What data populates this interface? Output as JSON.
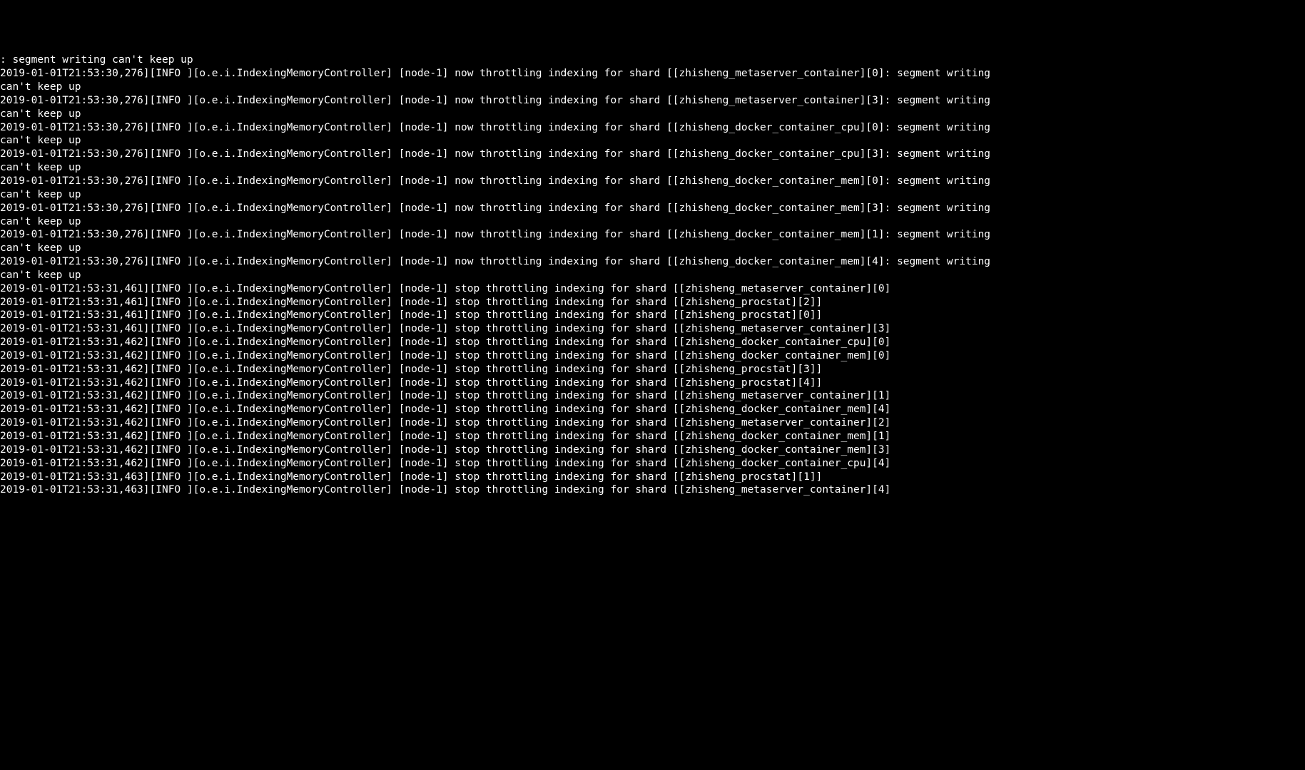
{
  "lines": [
    ": segment writing can't keep up",
    "2019-01-01T21:53:30,276][INFO ][o.e.i.IndexingMemoryController] [node-1] now throttling indexing for shard [[zhisheng_metaserver_container][0]: segment writing can't keep up",
    "2019-01-01T21:53:30,276][INFO ][o.e.i.IndexingMemoryController] [node-1] now throttling indexing for shard [[zhisheng_metaserver_container][3]: segment writing can't keep up",
    "2019-01-01T21:53:30,276][INFO ][o.e.i.IndexingMemoryController] [node-1] now throttling indexing for shard [[zhisheng_docker_container_cpu][0]: segment writing can't keep up",
    "2019-01-01T21:53:30,276][INFO ][o.e.i.IndexingMemoryController] [node-1] now throttling indexing for shard [[zhisheng_docker_container_cpu][3]: segment writing can't keep up",
    "2019-01-01T21:53:30,276][INFO ][o.e.i.IndexingMemoryController] [node-1] now throttling indexing for shard [[zhisheng_docker_container_mem][0]: segment writing can't keep up",
    "2019-01-01T21:53:30,276][INFO ][o.e.i.IndexingMemoryController] [node-1] now throttling indexing for shard [[zhisheng_docker_container_mem][3]: segment writing can't keep up",
    "2019-01-01T21:53:30,276][INFO ][o.e.i.IndexingMemoryController] [node-1] now throttling indexing for shard [[zhisheng_docker_container_mem][1]: segment writing can't keep up",
    "2019-01-01T21:53:30,276][INFO ][o.e.i.IndexingMemoryController] [node-1] now throttling indexing for shard [[zhisheng_docker_container_mem][4]: segment writing can't keep up",
    "2019-01-01T21:53:31,461][INFO ][o.e.i.IndexingMemoryController] [node-1] stop throttling indexing for shard [[zhisheng_metaserver_container][0]",
    "2019-01-01T21:53:31,461][INFO ][o.e.i.IndexingMemoryController] [node-1] stop throttling indexing for shard [[zhisheng_procstat][2]]",
    "2019-01-01T21:53:31,461][INFO ][o.e.i.IndexingMemoryController] [node-1] stop throttling indexing for shard [[zhisheng_procstat][0]]",
    "2019-01-01T21:53:31,461][INFO ][o.e.i.IndexingMemoryController] [node-1] stop throttling indexing for shard [[zhisheng_metaserver_container][3]",
    "2019-01-01T21:53:31,462][INFO ][o.e.i.IndexingMemoryController] [node-1] stop throttling indexing for shard [[zhisheng_docker_container_cpu][0]",
    "2019-01-01T21:53:31,462][INFO ][o.e.i.IndexingMemoryController] [node-1] stop throttling indexing for shard [[zhisheng_docker_container_mem][0]",
    "2019-01-01T21:53:31,462][INFO ][o.e.i.IndexingMemoryController] [node-1] stop throttling indexing for shard [[zhisheng_procstat][3]]",
    "2019-01-01T21:53:31,462][INFO ][o.e.i.IndexingMemoryController] [node-1] stop throttling indexing for shard [[zhisheng_procstat][4]]",
    "2019-01-01T21:53:31,462][INFO ][o.e.i.IndexingMemoryController] [node-1] stop throttling indexing for shard [[zhisheng_metaserver_container][1]",
    "2019-01-01T21:53:31,462][INFO ][o.e.i.IndexingMemoryController] [node-1] stop throttling indexing for shard [[zhisheng_docker_container_mem][4]",
    "2019-01-01T21:53:31,462][INFO ][o.e.i.IndexingMemoryController] [node-1] stop throttling indexing for shard [[zhisheng_metaserver_container][2]",
    "2019-01-01T21:53:31,462][INFO ][o.e.i.IndexingMemoryController] [node-1] stop throttling indexing for shard [[zhisheng_docker_container_mem][1]",
    "2019-01-01T21:53:31,462][INFO ][o.e.i.IndexingMemoryController] [node-1] stop throttling indexing for shard [[zhisheng_docker_container_mem][3]",
    "2019-01-01T21:53:31,462][INFO ][o.e.i.IndexingMemoryController] [node-1] stop throttling indexing for shard [[zhisheng_docker_container_cpu][4]",
    "2019-01-01T21:53:31,463][INFO ][o.e.i.IndexingMemoryController] [node-1] stop throttling indexing for shard [[zhisheng_procstat][1]]",
    "2019-01-01T21:53:31,463][INFO ][o.e.i.IndexingMemoryController] [node-1] stop throttling indexing for shard [[zhisheng_metaserver_container][4]"
  ]
}
